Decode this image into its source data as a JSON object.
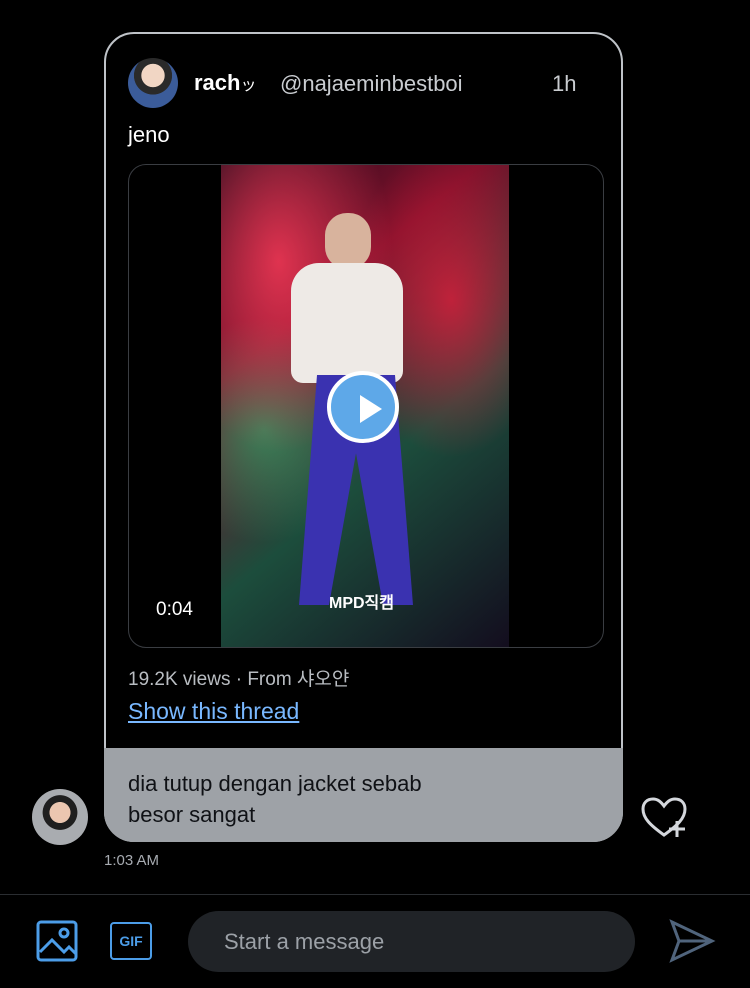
{
  "tweet": {
    "display_name": "rach",
    "display_name_suffix": "ッ",
    "handle": "@najaeminbestboi",
    "time": "1h",
    "text": "jeno",
    "video": {
      "duration": "0:04",
      "watermark": "MPD직캠"
    },
    "views": "19.2K views · From 샤오얀",
    "thread_link": "Show this thread"
  },
  "reply": {
    "text": "dia tutup dengan jacket sebab\nbesor sangat",
    "timestamp": "1:03 AM"
  },
  "composer": {
    "placeholder": "Start a message",
    "gif_label": "GIF"
  },
  "icons": {
    "heart_add": "heart-plus-icon",
    "image": "image-icon",
    "send": "send-icon",
    "play": "play-icon"
  },
  "colors": {
    "accent": "#4c9de8",
    "link": "#79b8ff",
    "reply_bubble": "#9ea2a7"
  }
}
